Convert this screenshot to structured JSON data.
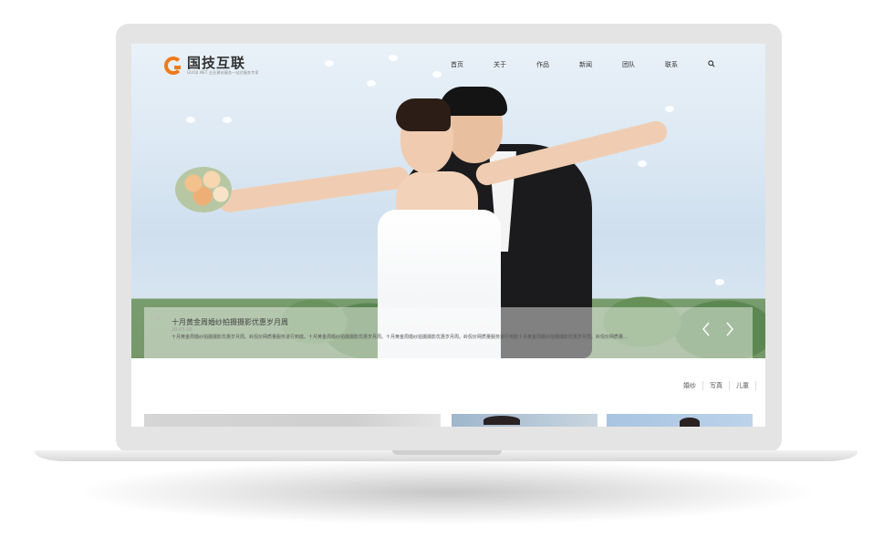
{
  "site": {
    "logo_name": "国技互联",
    "logo_tagline": "GUOJI.NET 企业建站服务一站式服务专家",
    "brand_color": "#ef7a1a"
  },
  "nav": {
    "items": [
      "首页",
      "关于",
      "作品",
      "新闻",
      "团队",
      "联系"
    ],
    "search_icon": "search-icon"
  },
  "hero": {
    "caption_title": "十月黄金周婚纱拍摄摄影优惠岁月周",
    "caption_date": "20-07-10",
    "caption_desc": "十月黄金周婚纱拍摄摄影优惠岁月周。岭侃价网质量服务进行到底。十月黄金周婚纱拍摄摄影优惠岁月周。十月黄金周婚纱拍摄摄影优惠岁月周。岭侃价网质量服务进行到底十月黄金周婚纱拍摄摄影优惠岁月周。岭侃价网质量...",
    "prev_icon": "chevron-left-icon",
    "next_icon": "chevron-right-icon"
  },
  "filters": [
    "婚纱",
    "写真",
    "儿童"
  ]
}
